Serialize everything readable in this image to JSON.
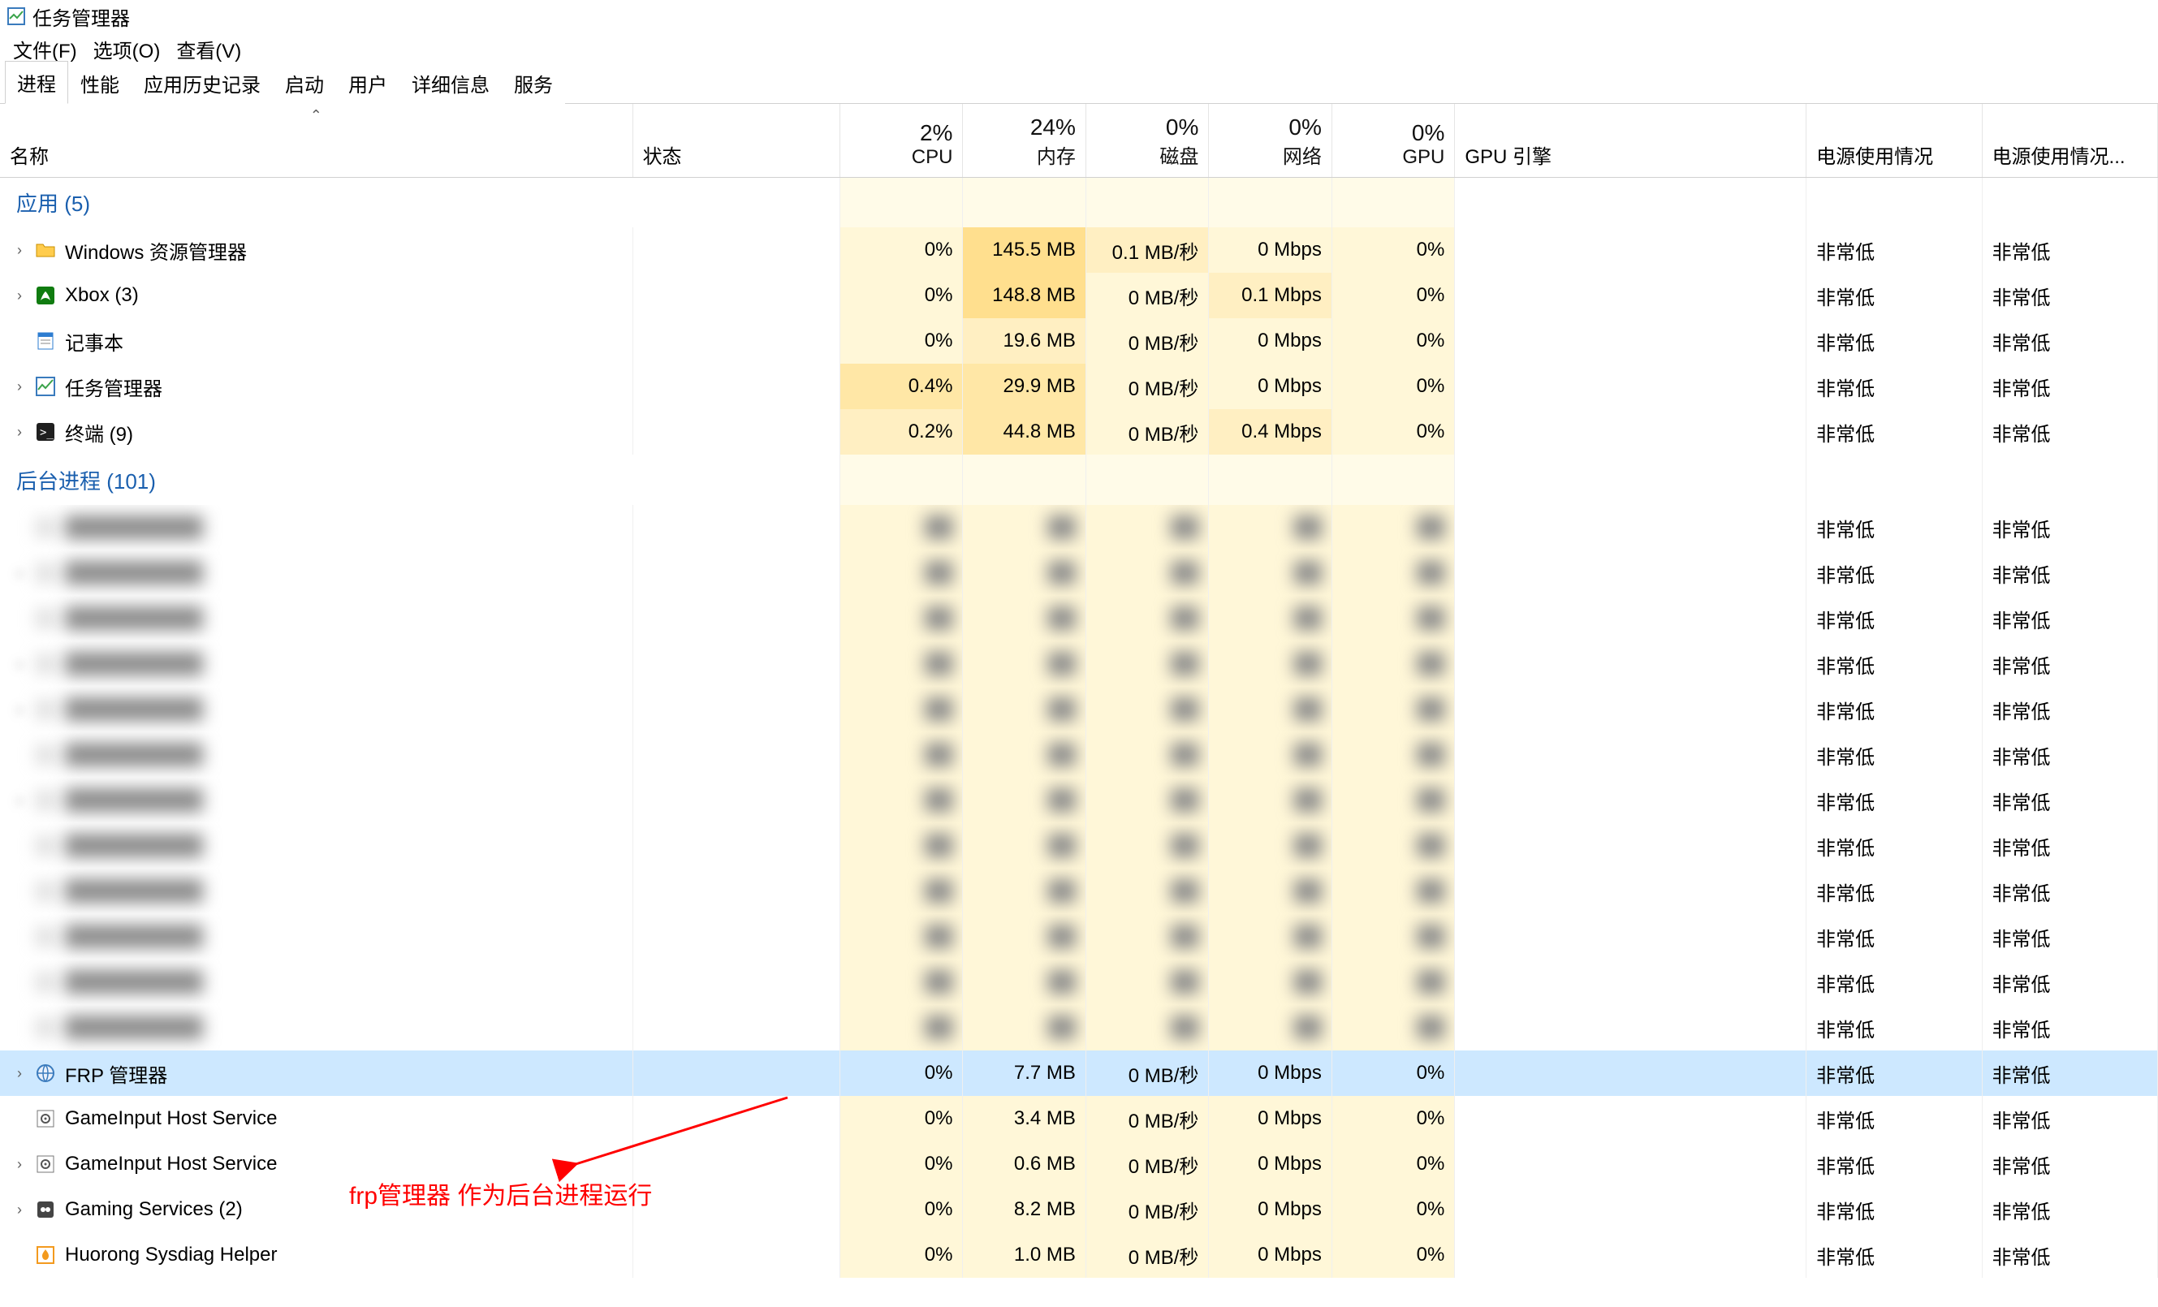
{
  "window": {
    "title": "任务管理器"
  },
  "menubar": {
    "file": "文件(F)",
    "options": "选项(O)",
    "view": "查看(V)"
  },
  "tabs": {
    "processes": "进程",
    "performance": "性能",
    "app_history": "应用历史记录",
    "startup": "启动",
    "users": "用户",
    "details": "详细信息",
    "services": "服务"
  },
  "columns": {
    "name": "名称",
    "status": "状态",
    "cpu": {
      "value": "2%",
      "label": "CPU"
    },
    "mem": {
      "value": "24%",
      "label": "内存"
    },
    "disk": {
      "value": "0%",
      "label": "磁盘"
    },
    "net": {
      "value": "0%",
      "label": "网络"
    },
    "gpu": {
      "value": "0%",
      "label": "GPU"
    },
    "gpu_engine": "GPU 引擎",
    "power": "电源使用情况",
    "power_trend": "电源使用情况..."
  },
  "groups": {
    "apps": "应用 (5)",
    "background": "后台进程 (101)"
  },
  "apps": [
    {
      "icon": "folder",
      "name": "Windows 资源管理器",
      "expandable": true,
      "cpu": "0%",
      "mem": "145.5 MB",
      "disk": "0.1 MB/秒",
      "net": "0 Mbps",
      "gpu": "0%",
      "power": "非常低",
      "power_trend": "非常低"
    },
    {
      "icon": "xbox",
      "name": "Xbox (3)",
      "expandable": true,
      "cpu": "0%",
      "mem": "148.8 MB",
      "disk": "0 MB/秒",
      "net": "0.1 Mbps",
      "gpu": "0%",
      "power": "非常低",
      "power_trend": "非常低"
    },
    {
      "icon": "notepad",
      "name": "记事本",
      "expandable": false,
      "cpu": "0%",
      "mem": "19.6 MB",
      "disk": "0 MB/秒",
      "net": "0 Mbps",
      "gpu": "0%",
      "power": "非常低",
      "power_trend": "非常低"
    },
    {
      "icon": "taskmgr",
      "name": "任务管理器",
      "expandable": true,
      "cpu": "0.4%",
      "mem": "29.9 MB",
      "disk": "0 MB/秒",
      "net": "0 Mbps",
      "gpu": "0%",
      "power": "非常低",
      "power_trend": "非常低"
    },
    {
      "icon": "terminal",
      "name": "终端 (9)",
      "expandable": true,
      "cpu": "0.2%",
      "mem": "44.8 MB",
      "disk": "0 MB/秒",
      "net": "0.4 Mbps",
      "gpu": "0%",
      "power": "非常低",
      "power_trend": "非常低"
    }
  ],
  "background": [
    {
      "blurred": true,
      "expandable": false,
      "power": "非常低",
      "power_trend": "非常低"
    },
    {
      "blurred": true,
      "expandable": true,
      "power": "非常低",
      "power_trend": "非常低"
    },
    {
      "blurred": true,
      "expandable": false,
      "power": "非常低",
      "power_trend": "非常低"
    },
    {
      "blurred": true,
      "expandable": true,
      "power": "非常低",
      "power_trend": "非常低"
    },
    {
      "blurred": true,
      "expandable": true,
      "power": "非常低",
      "power_trend": "非常低"
    },
    {
      "blurred": true,
      "expandable": false,
      "power": "非常低",
      "power_trend": "非常低"
    },
    {
      "blurred": true,
      "expandable": true,
      "power": "非常低",
      "power_trend": "非常低"
    },
    {
      "blurred": true,
      "expandable": false,
      "power": "非常低",
      "power_trend": "非常低"
    },
    {
      "blurred": true,
      "expandable": false,
      "power": "非常低",
      "power_trend": "非常低"
    },
    {
      "blurred": true,
      "expandable": false,
      "power": "非常低",
      "power_trend": "非常低"
    },
    {
      "blurred": true,
      "expandable": false,
      "power": "非常低",
      "power_trend": "非常低"
    },
    {
      "blurred": true,
      "expandable": false,
      "power": "非常低",
      "power_trend": "非常低"
    },
    {
      "icon": "globe",
      "name": "FRP 管理器",
      "expandable": true,
      "selected": true,
      "cpu": "0%",
      "mem": "7.7 MB",
      "disk": "0 MB/秒",
      "net": "0 Mbps",
      "gpu": "0%",
      "power": "非常低",
      "power_trend": "非常低"
    },
    {
      "icon": "service",
      "name": "GameInput Host Service",
      "expandable": false,
      "cpu": "0%",
      "mem": "3.4 MB",
      "disk": "0 MB/秒",
      "net": "0 Mbps",
      "gpu": "0%",
      "power": "非常低",
      "power_trend": "非常低"
    },
    {
      "icon": "service",
      "name": "GameInput Host Service",
      "expandable": true,
      "cpu": "0%",
      "mem": "0.6 MB",
      "disk": "0 MB/秒",
      "net": "0 Mbps",
      "gpu": "0%",
      "power": "非常低",
      "power_trend": "非常低"
    },
    {
      "icon": "gaming",
      "name": "Gaming Services (2)",
      "expandable": true,
      "cpu": "0%",
      "mem": "8.2 MB",
      "disk": "0 MB/秒",
      "net": "0 Mbps",
      "gpu": "0%",
      "power": "非常低",
      "power_trend": "非常低"
    },
    {
      "icon": "huorong",
      "name": "Huorong Sysdiag Helper",
      "expandable": false,
      "cpu": "0%",
      "mem": "1.0 MB",
      "disk": "0 MB/秒",
      "net": "0 Mbps",
      "gpu": "0%",
      "power": "非常低",
      "power_trend": "非常低"
    }
  ],
  "annotation": {
    "text": "frp管理器 作为后台进程运行"
  },
  "heat": {
    "apps": [
      [
        "h0",
        "h3",
        "h1",
        "h0",
        "h0"
      ],
      [
        "h0",
        "h3",
        "h0",
        "h1",
        "h0"
      ],
      [
        "h0",
        "h1",
        "h0",
        "h0",
        "h0"
      ],
      [
        "h2",
        "h2",
        "h0",
        "h0",
        "h0"
      ],
      [
        "h1",
        "h2",
        "h0",
        "h1",
        "h0"
      ]
    ],
    "background_visible": [
      [
        "h0",
        "h0",
        "h0",
        "h0",
        "h0"
      ],
      [
        "h0",
        "h0",
        "h0",
        "h0",
        "h0"
      ],
      [
        "h0",
        "h0",
        "h0",
        "h0",
        "h0"
      ],
      [
        "h0",
        "h0",
        "h0",
        "h0",
        "h0"
      ],
      [
        "h0",
        "h0",
        "h0",
        "h0",
        "h0"
      ]
    ]
  }
}
